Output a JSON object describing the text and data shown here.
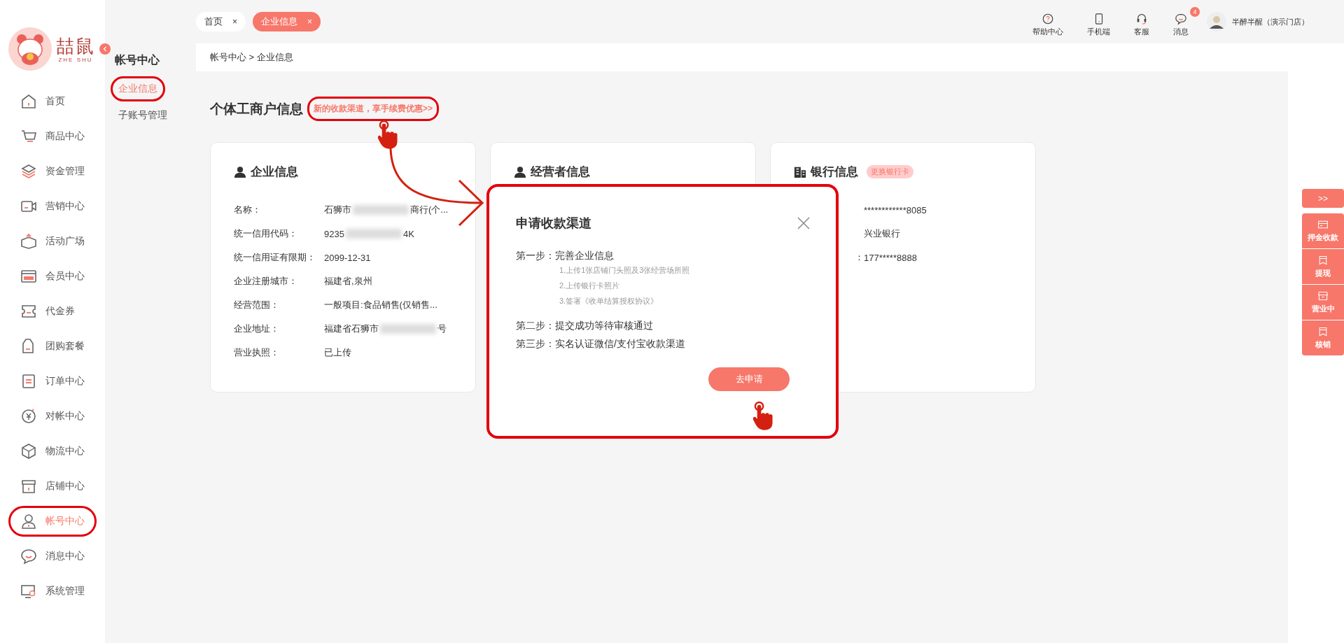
{
  "logo": {
    "text": "喆鼠",
    "subtext": "ZHE SHU"
  },
  "sidebar": {
    "items": [
      {
        "label": "首页",
        "selected": false,
        "highlighted": false
      },
      {
        "label": "商品中心",
        "selected": false,
        "highlighted": false
      },
      {
        "label": "资金管理",
        "selected": false,
        "highlighted": false
      },
      {
        "label": "营销中心",
        "selected": false,
        "highlighted": false
      },
      {
        "label": "活动广场",
        "selected": false,
        "highlighted": false
      },
      {
        "label": "会员中心",
        "selected": false,
        "highlighted": false
      },
      {
        "label": "代金券",
        "selected": false,
        "highlighted": false
      },
      {
        "label": "团购套餐",
        "selected": false,
        "highlighted": false
      },
      {
        "label": "订单中心",
        "selected": false,
        "highlighted": false
      },
      {
        "label": "对帐中心",
        "selected": false,
        "highlighted": false
      },
      {
        "label": "物流中心",
        "selected": false,
        "highlighted": false
      },
      {
        "label": "店铺中心",
        "selected": false,
        "highlighted": false
      },
      {
        "label": "帐号中心",
        "selected": true,
        "highlighted": true
      },
      {
        "label": "消息中心",
        "selected": false,
        "highlighted": false
      },
      {
        "label": "系统管理",
        "selected": false,
        "highlighted": false
      }
    ]
  },
  "submenu": {
    "title": "帐号中心",
    "items": [
      {
        "label": "企业信息",
        "selected": true,
        "highlighted": true
      },
      {
        "label": "子账号管理",
        "selected": false,
        "highlighted": false
      }
    ]
  },
  "tabs": [
    {
      "label": "首页",
      "close": "×",
      "selected": false
    },
    {
      "label": "企业信息",
      "close": "×",
      "selected": true
    }
  ],
  "header_actions": [
    {
      "label": "帮助中心"
    },
    {
      "label": "手机端"
    },
    {
      "label": "客服"
    },
    {
      "label": "消息",
      "badge": "4"
    }
  ],
  "user": {
    "name": "半醉半醒（演示门店）"
  },
  "breadcrumb": "帐号中心 > 企业信息",
  "page_title": "个体工商户信息",
  "promo_link": {
    "text": "新的收款渠道，享手续费优惠>>",
    "highlighted": true
  },
  "cards": [
    {
      "kind": "company",
      "title": "企业信息",
      "rows": [
        {
          "label": "名称：",
          "value": "石狮市",
          "value_end": "商行(个...",
          "redacted": true
        },
        {
          "label": "统一信用代码：",
          "value": "9235",
          "value_end": "4K",
          "redacted": true
        },
        {
          "label": "统一信用证有限期：",
          "value": "2099-12-31"
        },
        {
          "label": "企业注册城市：",
          "value": "福建省,泉州"
        },
        {
          "label": "经营范围：",
          "value": "一般项目:食品销售(仅销售..."
        },
        {
          "label": "企业地址：",
          "value": "福建省石狮市",
          "value_end": "号",
          "redacted": true
        },
        {
          "label": "营业执照：",
          "value": "已上传"
        }
      ]
    },
    {
      "kind": "operator",
      "title": "经营者信息"
    },
    {
      "kind": "bank",
      "title": "银行信息",
      "badge": "更换银行卡",
      "rows": [
        {
          "value": "************8085"
        },
        {
          "value": "兴业银行"
        },
        {
          "label": "：",
          "value": "177*****8888"
        }
      ]
    }
  ],
  "modal": {
    "title": "申请收款渠道",
    "highlighted": true,
    "steps": [
      {
        "label": "第一步：",
        "text": "完善企业信息",
        "notes": [
          "1.上传1张店铺门头照及3张经营场所照",
          "2.上传银行卡照片",
          "3.签署《收单结算授权协议》"
        ]
      },
      {
        "label": "第二步：",
        "text": "提交成功等待审核通过"
      },
      {
        "label": "第三步：",
        "text": "实名认证微信/支付宝收款渠道"
      }
    ],
    "button": "去申请"
  },
  "float_panel": {
    "toggle": ">>",
    "buttons": [
      {
        "label": "押金收款"
      },
      {
        "label": "提现"
      },
      {
        "label": "营业中"
      },
      {
        "label": "核销"
      }
    ]
  }
}
